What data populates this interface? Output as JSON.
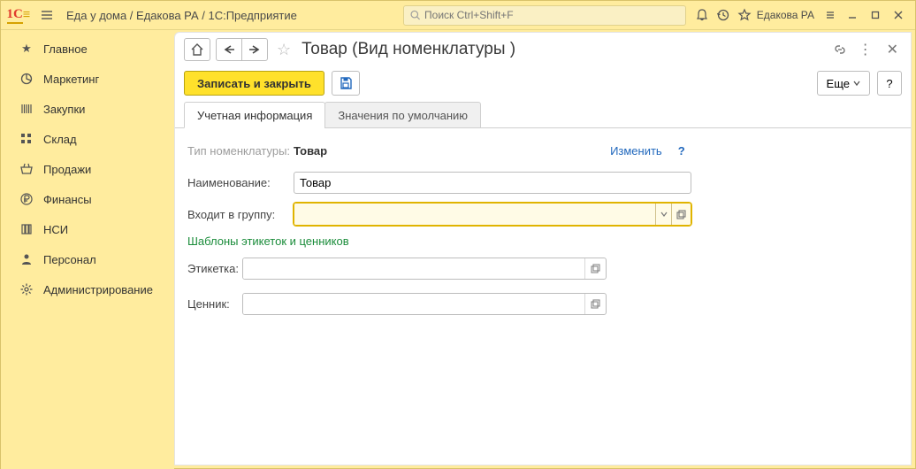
{
  "topbar": {
    "title": "Еда у дома / Едакова РА / 1С:Предприятие",
    "search_placeholder": "Поиск Ctrl+Shift+F",
    "username": "Едакова РА"
  },
  "sidebar": {
    "items": [
      {
        "label": "Главное"
      },
      {
        "label": "Маркетинг"
      },
      {
        "label": "Закупки"
      },
      {
        "label": "Склад"
      },
      {
        "label": "Продажи"
      },
      {
        "label": "Финансы"
      },
      {
        "label": "НСИ"
      },
      {
        "label": "Персонал"
      },
      {
        "label": "Администрирование"
      }
    ]
  },
  "page": {
    "title": "Товар (Вид номенклатуры )"
  },
  "toolbar": {
    "write_close": "Записать и закрыть",
    "more": "Еще",
    "help": "?"
  },
  "tabs": {
    "tab1": "Учетная информация",
    "tab2": "Значения по умолчанию"
  },
  "form": {
    "type_label": "Тип номенклатуры:",
    "type_value": "Товар",
    "change": "Изменить",
    "name_label": "Наименование:",
    "name_value": "Товар",
    "group_label": "Входит в группу:",
    "group_value": "",
    "templates_title": "Шаблоны этикеток и ценников",
    "etiketka_label": "Этикетка:",
    "cennik_label": "Ценник:"
  }
}
